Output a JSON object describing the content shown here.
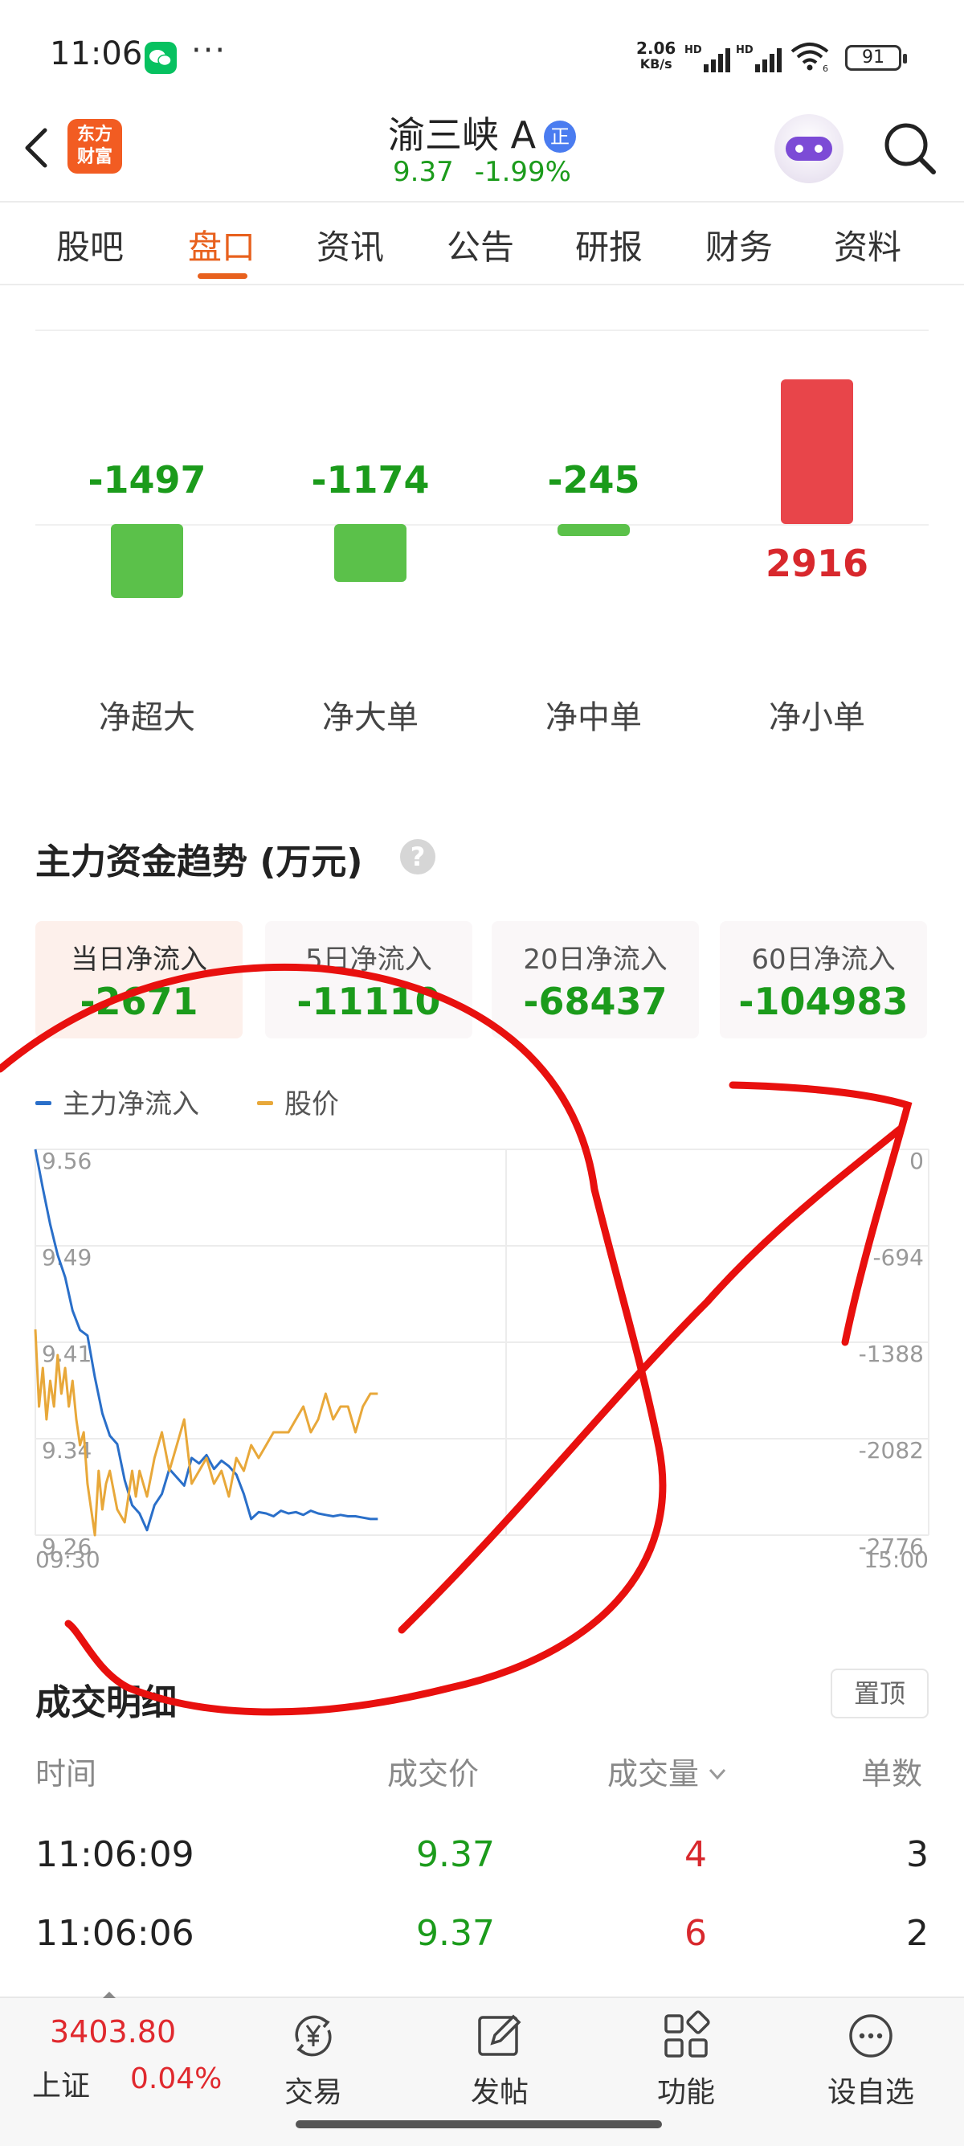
{
  "status_bar": {
    "time": "11:06",
    "more": "···",
    "net_speed_value": "2.06",
    "net_speed_unit": "KB/s",
    "signal_label_1": "HD",
    "signal_label_2": "HD",
    "wifi_label": "6",
    "battery": "91"
  },
  "header": {
    "logo_line1": "东方",
    "logo_line2": "财富",
    "stock_name": "渝三峡 A",
    "badge": "正",
    "price": "9.37",
    "change_pct": "-1.99%"
  },
  "tabs": [
    "股吧",
    "盘口",
    "资讯",
    "公告",
    "研报",
    "财务",
    "资料"
  ],
  "active_tab": "盘口",
  "fund_flow": {
    "items": [
      {
        "label": "净超大",
        "value": "-1497",
        "amount": -1497
      },
      {
        "label": "净大单",
        "value": "-1174",
        "amount": -1174
      },
      {
        "label": "净中单",
        "value": "-245",
        "amount": -245
      },
      {
        "label": "净小单",
        "value": "2916",
        "amount": 2916
      }
    ],
    "colors": {
      "positive": "#e8454a",
      "negative": "#5bc14a",
      "positive_text": "#d8282d",
      "negative_text": "#1b9b1b"
    }
  },
  "trend": {
    "title": "主力资金趋势 (万元)",
    "help": "?",
    "periods": [
      {
        "label": "当日净流入",
        "value": "-2671"
      },
      {
        "label": "5日净流入",
        "value": "-11110"
      },
      {
        "label": "20日净流入",
        "value": "-68437"
      },
      {
        "label": "60日净流入",
        "value": "-104983"
      }
    ],
    "active_period": 0,
    "legend": [
      {
        "name": "主力净流入",
        "color": "#2a6fc9"
      },
      {
        "name": "股价",
        "color": "#e8a83a"
      }
    ]
  },
  "chart_data": {
    "type": "line",
    "x_start_label": "09:30",
    "x_end_label": "15:00",
    "left_axis_ticks": [
      "9.56",
      "9.49",
      "9.41",
      "9.34",
      "9.26"
    ],
    "right_axis_ticks": [
      "0",
      "-694",
      "-1388",
      "-2082",
      "-2776"
    ],
    "left_ylim": [
      9.26,
      9.56
    ],
    "right_ylim": [
      -2776,
      0
    ],
    "x_minutes_total": 240,
    "series": [
      {
        "name": "主力净流入",
        "axis": "right",
        "color": "#2a6fc9",
        "x": [
          0,
          2,
          4,
          6,
          8,
          10,
          12,
          14,
          16,
          18,
          20,
          22,
          24,
          26,
          28,
          30,
          32,
          34,
          36,
          38,
          40,
          42,
          44,
          46,
          48,
          50,
          52,
          54,
          56,
          58,
          60,
          62,
          64,
          66,
          68,
          70,
          72,
          74,
          76,
          78,
          80,
          82,
          84,
          86,
          88,
          90,
          92
        ],
        "values": [
          0,
          -280,
          -540,
          -760,
          -920,
          -1160,
          -1300,
          -1340,
          -1640,
          -1900,
          -2060,
          -2120,
          -2380,
          -2560,
          -2620,
          -2740,
          -2560,
          -2480,
          -2300,
          -2360,
          -2420,
          -2220,
          -2260,
          -2200,
          -2300,
          -2240,
          -2280,
          -2340,
          -2480,
          -2660,
          -2610,
          -2620,
          -2640,
          -2600,
          -2620,
          -2610,
          -2630,
          -2600,
          -2620,
          -2630,
          -2640,
          -2630,
          -2640,
          -2640,
          -2650,
          -2660,
          -2660
        ]
      },
      {
        "name": "股价",
        "axis": "left",
        "color": "#e8a83a",
        "x": [
          0,
          1,
          2,
          3,
          4,
          5,
          6,
          7,
          8,
          9,
          10,
          11,
          12,
          13,
          14,
          15,
          16,
          17,
          18,
          19,
          20,
          22,
          24,
          26,
          27,
          28,
          30,
          32,
          34,
          36,
          38,
          40,
          42,
          44,
          46,
          48,
          50,
          52,
          54,
          56,
          58,
          60,
          62,
          64,
          66,
          68,
          70,
          72,
          74,
          76,
          78,
          80,
          82,
          84,
          86,
          88,
          90,
          92
        ],
        "values": [
          9.42,
          9.36,
          9.39,
          9.35,
          9.38,
          9.36,
          9.4,
          9.37,
          9.39,
          9.36,
          9.38,
          9.35,
          9.33,
          9.34,
          9.3,
          9.28,
          9.26,
          9.31,
          9.28,
          9.3,
          9.31,
          9.28,
          9.27,
          9.31,
          9.29,
          9.31,
          9.29,
          9.32,
          9.34,
          9.31,
          9.33,
          9.35,
          9.3,
          9.31,
          9.32,
          9.3,
          9.31,
          9.29,
          9.32,
          9.31,
          9.33,
          9.32,
          9.33,
          9.34,
          9.34,
          9.34,
          9.35,
          9.36,
          9.34,
          9.35,
          9.37,
          9.35,
          9.36,
          9.36,
          9.34,
          9.36,
          9.37,
          9.37
        ]
      }
    ]
  },
  "trade_detail": {
    "title": "成交明细",
    "pin_label": "置顶",
    "columns": [
      "时间",
      "成交价",
      "成交量",
      "单数"
    ],
    "rows": [
      {
        "time": "11:06:09",
        "price": "9.37",
        "volume": "4",
        "count": "3"
      },
      {
        "time": "11:06:06",
        "price": "9.37",
        "volume": "6",
        "count": "2"
      }
    ]
  },
  "bottom_bar": {
    "index_value": "3403.80",
    "index_name": "上证",
    "index_change": "0.04%",
    "nav": [
      {
        "label": "交易",
        "icon": "trade-yen-icon"
      },
      {
        "label": "发帖",
        "icon": "edit-post-icon"
      },
      {
        "label": "功能",
        "icon": "grid-apps-icon"
      },
      {
        "label": "设自选",
        "icon": "more-circle-icon"
      }
    ]
  },
  "annotation": {
    "color": "#e8100e",
    "kind": "hand-drawn red marker scribble"
  }
}
